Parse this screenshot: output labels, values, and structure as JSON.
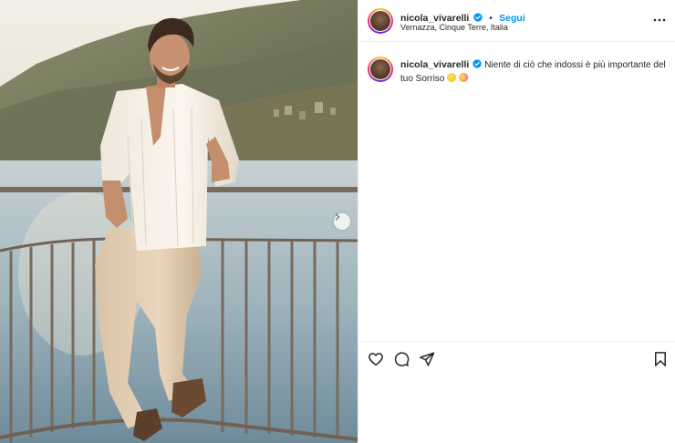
{
  "post": {
    "image_alt": "Man in a white shirt and beige trousers leaning on a railing above the sea at Vernazza",
    "carousel_next": "chevron-right-icon"
  },
  "header": {
    "username": "nicola_vivarelli",
    "verified_icon": "verified-badge-icon",
    "separator": "•",
    "follow_label": "Segui",
    "location": "Vernazza, Cinque Terre, Italia",
    "more_icon": "more-options-icon"
  },
  "caption": {
    "username": "nicola_vivarelli",
    "text": "Niente di ciò che indossi è più importante del tuo Sorriso",
    "emojis": [
      "smiling-face-emoji",
      "blushing-face-emoji"
    ]
  },
  "actions": {
    "like_icon": "heart-icon",
    "comment_icon": "comment-icon",
    "share_icon": "share-icon",
    "save_icon": "bookmark-icon"
  },
  "colors": {
    "accent": "#0095f6",
    "text": "#262626",
    "verified": "#0095f6",
    "divider": "#efefef"
  }
}
